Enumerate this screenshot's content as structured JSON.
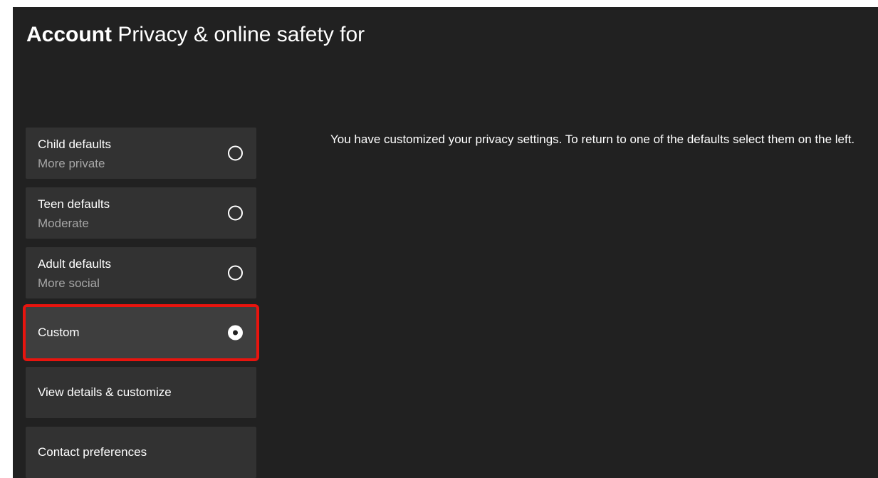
{
  "header": {
    "section": "Account",
    "title": "Privacy & online safety for"
  },
  "options": [
    {
      "label": "Child defaults",
      "sublabel": "More private",
      "selected": false
    },
    {
      "label": "Teen defaults",
      "sublabel": "Moderate",
      "selected": false
    },
    {
      "label": "Adult defaults",
      "sublabel": "More social",
      "selected": false
    },
    {
      "label": "Custom",
      "selected": true
    }
  ],
  "actions": {
    "view_details": "View details & customize",
    "contact_preferences": "Contact preferences"
  },
  "description": "You have customized your privacy settings. To return to one of the defaults select them on the left.",
  "colors": {
    "background": "#212121",
    "tile": "#323232",
    "highlight_border": "#e8140e",
    "secondary_text": "#a6a6a6"
  }
}
